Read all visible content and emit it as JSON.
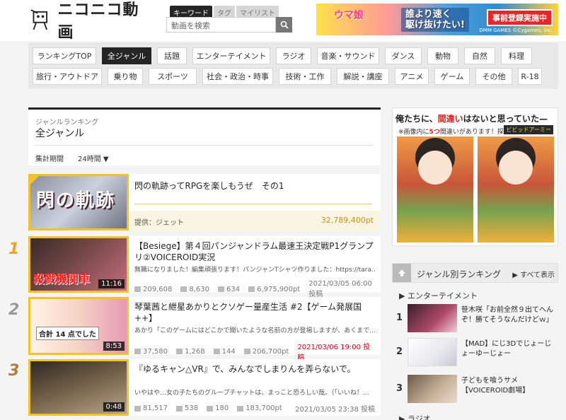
{
  "header": {
    "logo_text": "ニコニコ動画",
    "search_tabs": [
      "キーワード",
      "タグ",
      "マイリスト"
    ],
    "search_placeholder": "動画を検索",
    "banner": {
      "title": "ウマ娘",
      "line1": "誰より速く",
      "line2": "駆け抜けたい!",
      "cta": "事前登録実施中",
      "credit": "DMM GAMES ©Cygames, Inc."
    }
  },
  "genres": {
    "row1": [
      "ランキングTOP",
      "全ジャンル",
      "話題",
      "エンターテイメント",
      "ラジオ",
      "音楽・サウンド",
      "ダンス",
      "動物",
      "自然",
      "料理"
    ],
    "row2": [
      "旅行・アウトドア",
      "乗り物",
      "スポーツ",
      "社会・政治・時事",
      "技術・工作",
      "解説・講座",
      "アニメ",
      "ゲーム",
      "その他",
      "R-18"
    ],
    "active": "全ジャンル"
  },
  "ranking_header": {
    "subtitle": "ジャンルランキング",
    "title": "全ジャンル",
    "period_label": "集計期間",
    "period_value": "24時間 ▼"
  },
  "ad_video": {
    "thumb_text": "閃の軌跡",
    "title": "閃の軌跡ってRPGを楽しもうぜ　その1",
    "provider": "提供：ジェット",
    "points": "32,789,400pt"
  },
  "videos": [
    {
      "rank": "1",
      "title": "【Besiege】第４回パンジャンドラム最速王決定戦P1グランプリ②VOICEROID実況",
      "desc": "無職になりました！編集頑張ります！パンジャンTシャツ作りました：https://tara...",
      "thumb_text": "殺戮機関車",
      "duration": "11:16",
      "views": "209,608",
      "comments": "8,630",
      "mylists": "634",
      "points": "6,975,900pt",
      "date": "2021/03/05 06:00 投稿",
      "date_hot": false
    },
    {
      "rank": "2",
      "title": "琴葉茜と紲星あかりとクソゲー量産生活 #2【ゲーム発展国++】",
      "desc": "あかり「このゲームにはどこかで聞いたような名前の方が登場しますが、あくまで...",
      "thumb_text": "合計 14 点でした",
      "duration": "8:53",
      "views": "37,580",
      "comments": "1,268",
      "mylists": "144",
      "points": "206,700pt",
      "date": "2021/03/06 19:00 投稿",
      "date_hot": true
    },
    {
      "rank": "3",
      "title": "『ゆるキャン△VR』で、みんなでしまりんを弄らないで。",
      "desc": "いやはや…女の子たちのグループチャットは、まっこと恐ろしい哉。（「いいね！...",
      "thumb_text": "",
      "duration": "0:48",
      "views": "81,517",
      "comments": "538",
      "mylists": "180",
      "points": "183,700pt",
      "date": "2021/03/05 23:38 投稿",
      "date_hot": false
    }
  ],
  "side_ad": {
    "title_prefix": "俺たちに、",
    "title_red": "間違い",
    "title_suffix": "はないと思っていた—",
    "sub_prefix": "※画像内に",
    "sub_red": "5つ",
    "sub_suffix": "間違いがあります！探してみよう！",
    "badge": "ビビッドアーミー"
  },
  "side_ranking": {
    "title": "ジャンル別ランキング",
    "all_link": "▶ すべて表示",
    "genre": "▶ エンターテイメント",
    "items": [
      {
        "num": "1",
        "title": "笹木咲「お前全然９出てへんぞ！勝てそうなんだけどｗ」"
      },
      {
        "num": "2",
        "title": "【MAD】にじ3Dでじょーじょーゆーじょー"
      },
      {
        "num": "3",
        "title": "子どもを喰うサメ【VOICEROID劇場】"
      }
    ],
    "next_genre": "▶ ラジオ"
  },
  "colors": {
    "accent_gold": "#f2c22b",
    "rank1": "#f0a020",
    "rank2": "#9a9a9a",
    "rank3": "#b47a3c",
    "hot_date": "#d0021b"
  }
}
